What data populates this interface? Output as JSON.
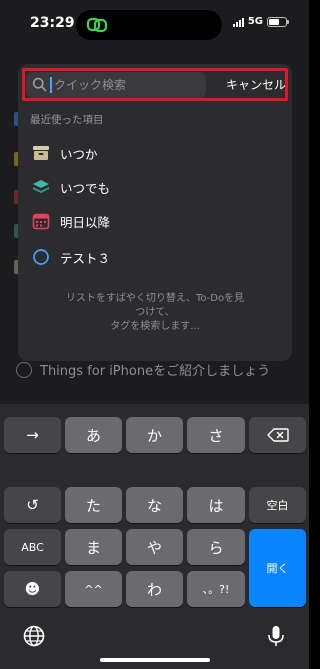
{
  "status_bar": {
    "time": "23:29",
    "network": "5G"
  },
  "search": {
    "placeholder": "クイック検索",
    "cancel_label": "キャンセル"
  },
  "popup": {
    "section_label": "最近使った項目",
    "items": [
      {
        "label": "いつか",
        "icon": "archive-box-icon",
        "color": "#d9cda8"
      },
      {
        "label": "いつでも",
        "icon": "stack-layers-icon",
        "color": "#3fb9a6"
      },
      {
        "label": "明日以降",
        "icon": "calendar-icon",
        "color": "#e8415a"
      },
      {
        "label": "テスト３",
        "icon": "circle-icon",
        "color": "#4aa3ff"
      }
    ],
    "hint_lines": [
      "リストをすばやく切り替え、To-Doを見",
      "つけて、",
      "タグを検索します..."
    ]
  },
  "background": {
    "promo_text": "Things for iPhoneをご紹介しましょう"
  },
  "keyboard": {
    "row1": [
      "→",
      "あ",
      "か",
      "さ",
      "⌫"
    ],
    "row2": [
      "↺",
      "た",
      "な",
      "は",
      "空白"
    ],
    "row3": [
      "ABC",
      "ま",
      "や",
      "ら",
      "開く"
    ],
    "row4": [
      "☻",
      "^^",
      "わ",
      "、。?!"
    ]
  },
  "colors": {
    "accent": "#0a84ff",
    "highlight": "#e0162b"
  }
}
